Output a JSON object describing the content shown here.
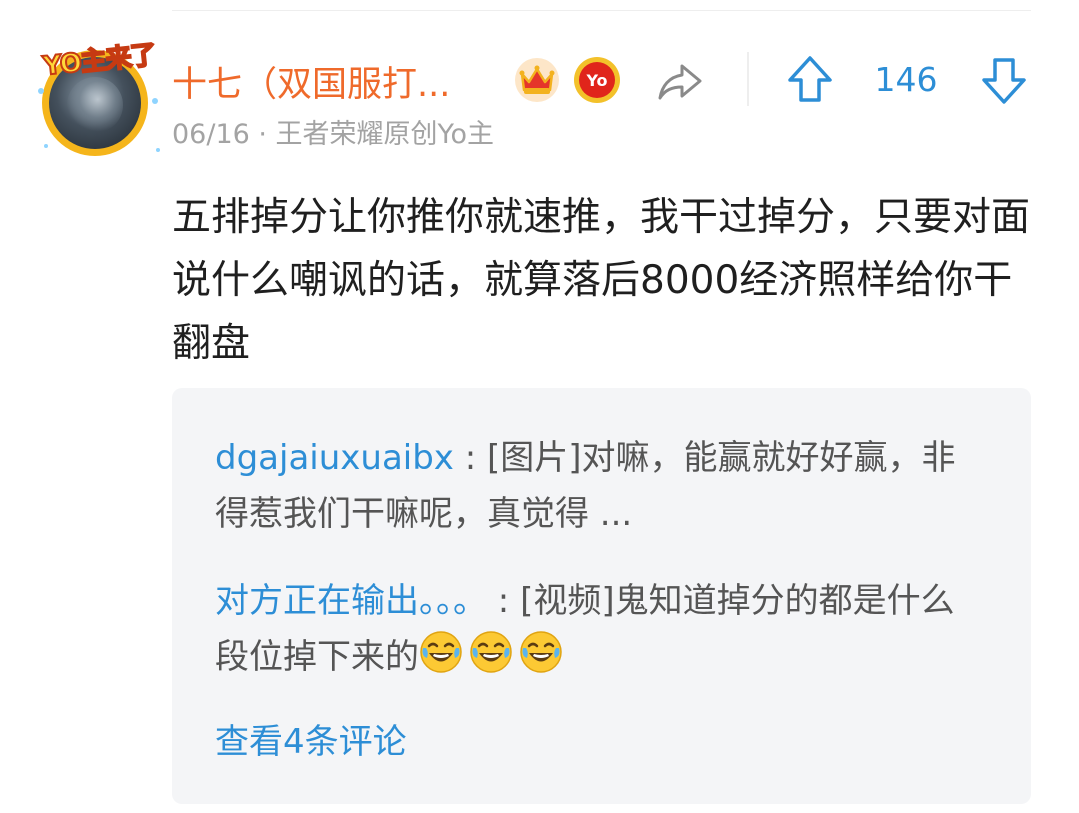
{
  "comment": {
    "avatar_badge_text": "YO主来了",
    "username": "十七（双国服打...",
    "meta": "06/16 · 王者荣耀原创Yo主",
    "badge_yo_text": "Yo",
    "vote_count": "146",
    "text": "五排掉分让你推你就速推，我干过掉分，只要对面说什么嘲讽的话，就算落后8000经济照样给你干翻盘"
  },
  "replies": [
    {
      "author": "dgajaiuxuaibx",
      "separator": " : ",
      "text": "[图片]对嘛，能赢就好好赢，非得惹我们干嘛呢，真觉得 ..."
    },
    {
      "author": "对方正在输出。。。",
      "separator": " : ",
      "text": "[视频]鬼知道掉分的都是什么段位掉下来的",
      "emojis": [
        "laugh-cry-icon",
        "laugh-cry-icon",
        "laugh-cry-icon"
      ]
    }
  ],
  "view_more": "查看4条评论",
  "colors": {
    "username": "#ef6a2b",
    "link": "#2d8ed6",
    "meta": "#a3a3a3",
    "reply_bg": "#f4f5f7"
  }
}
